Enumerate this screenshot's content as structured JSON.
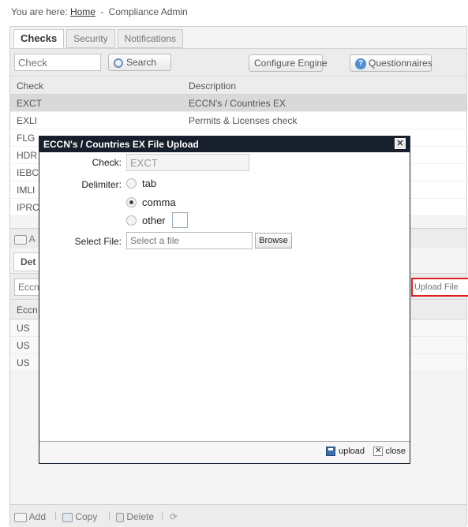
{
  "breadcrumb": {
    "prefix": "You are here:",
    "home": "Home",
    "separator": "-",
    "current": "Compliance Admin"
  },
  "tabs": [
    "Checks",
    "Security",
    "Notifications"
  ],
  "toolbar": {
    "check_placeholder": "Check",
    "search_label": "Search",
    "configure_label": "Configure Engine",
    "questionnaires_label": "Questionnaires"
  },
  "grid": {
    "columns": [
      "Check",
      "Description"
    ],
    "rows": [
      {
        "check": "EXCT",
        "description": "ECCN's / Countries EX"
      },
      {
        "check": "EXLI",
        "description": "Permits & Licenses check"
      },
      {
        "check": "FLG",
        "description": ""
      },
      {
        "check": "HDR",
        "description": ""
      },
      {
        "check": "IEBC",
        "description": ""
      },
      {
        "check": "IMLI",
        "description": ""
      },
      {
        "check": "IPRC",
        "description": ""
      }
    ],
    "add_label": "A"
  },
  "details": {
    "tab_label": "Det",
    "eccn_placeholder": "Eccn",
    "upload_file_label": "Upload File",
    "column": "Eccn",
    "rows": [
      "US",
      "US",
      "US"
    ]
  },
  "bottom_bar": {
    "add": "Add",
    "copy": "Copy",
    "delete": "Delete",
    "separator": "|"
  },
  "modal": {
    "title": "ECCN's / Countries EX File Upload",
    "check_label": "Check:",
    "check_value": "EXCT",
    "delimiter_label": "Delimiter:",
    "delimiters": [
      "tab",
      "comma",
      "other"
    ],
    "selected_delimiter": "comma",
    "file_label": "Select File:",
    "file_placeholder": "Select a file",
    "browse_label": "Browse",
    "upload_label": "upload",
    "close_label": "close"
  },
  "colors": {
    "modal_title_bg": "#161f2b",
    "upload_highlight": "#e02020",
    "selected_row": "#d9d9d9"
  }
}
